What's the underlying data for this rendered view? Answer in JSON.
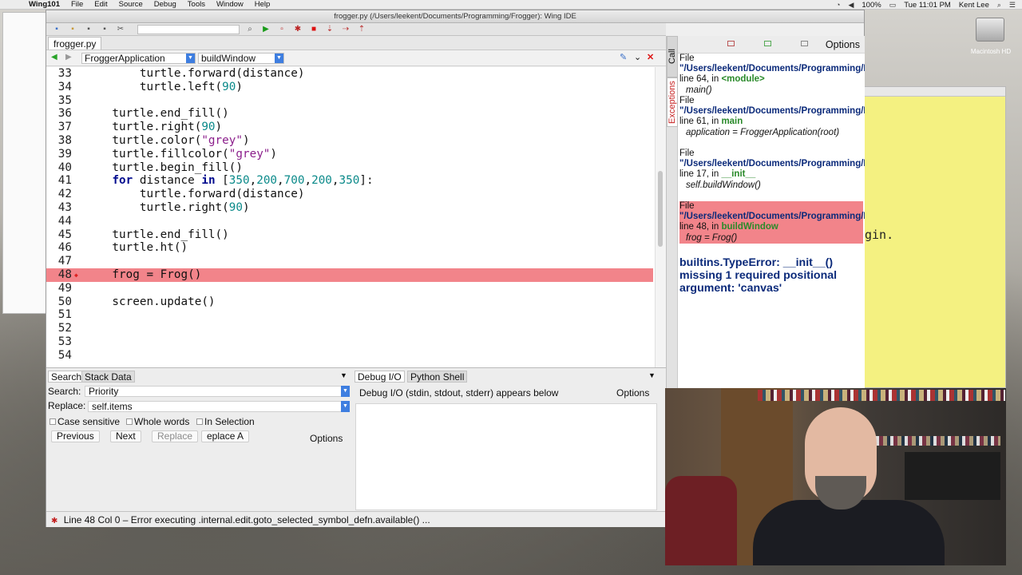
{
  "menubar": {
    "app": "Wing101",
    "items": [
      "File",
      "Edit",
      "Source",
      "Debug",
      "Tools",
      "Window",
      "Help"
    ],
    "battery": "100%",
    "clock": "Tue 11:01 PM",
    "user": "Kent Lee"
  },
  "desktop": {
    "hd_label": "Macintosh HD",
    "back_window_text": "gin."
  },
  "window": {
    "title": "frogger.py (/Users/leekent/Documents/Programming/Frogger): Wing IDE"
  },
  "editor": {
    "file_tab": "frogger.py",
    "class_combo": "FroggerApplication",
    "method_combo": "buildWindow",
    "lines": [
      {
        "n": "33",
        "html": "        turtle.forward(distance)"
      },
      {
        "n": "34",
        "html": "        turtle.left(90)"
      },
      {
        "n": "35",
        "html": ""
      },
      {
        "n": "36",
        "html": "    turtle.end_fill()"
      },
      {
        "n": "37",
        "html": "    turtle.right(90)"
      },
      {
        "n": "38",
        "html": "    turtle.color(\"grey\")"
      },
      {
        "n": "39",
        "html": "    turtle.fillcolor(\"grey\")"
      },
      {
        "n": "40",
        "html": "    turtle.begin_fill()"
      },
      {
        "n": "41",
        "html": "    for distance in [350,200,700,200,350]:"
      },
      {
        "n": "42",
        "html": "        turtle.forward(distance)"
      },
      {
        "n": "43",
        "html": "        turtle.right(90)"
      },
      {
        "n": "44",
        "html": ""
      },
      {
        "n": "45",
        "html": "    turtle.end_fill()"
      },
      {
        "n": "46",
        "html": "    turtle.ht()"
      },
      {
        "n": "47",
        "html": ""
      },
      {
        "n": "48",
        "html": "    frog = Frog()",
        "error": true
      },
      {
        "n": "49",
        "html": ""
      },
      {
        "n": "50",
        "html": "    screen.update()"
      },
      {
        "n": "51",
        "html": ""
      },
      {
        "n": "52",
        "html": ""
      },
      {
        "n": "53",
        "html": ""
      },
      {
        "n": "54",
        "html": ""
      }
    ]
  },
  "search_panel": {
    "tab_search": "Search",
    "tab_stack": "Stack Data",
    "search_label": "Search:",
    "search_value": "Priority",
    "replace_label": "Replace:",
    "replace_value": "self.items",
    "case_sensitive": "Case sensitive",
    "whole_words": "Whole words",
    "in_selection": "In Selection",
    "previous": "Previous",
    "next": "Next",
    "replace": "Replace",
    "replace_all": "eplace A",
    "options": "Options"
  },
  "debug_panel": {
    "tab_debug": "Debug I/O",
    "tab_shell": "Python Shell",
    "info": "Debug I/O (stdin, stdout, stderr) appears below",
    "options": "Options"
  },
  "status": {
    "text": "Line 48 Col 0 – Error executing .internal.edit.goto_selected_symbol_defn.available() ..."
  },
  "exceptions": {
    "vtab_call_stack": "Call Stack",
    "vtab_exceptions": "Exceptions",
    "options": "Options",
    "frames": [
      {
        "pre": "File ",
        "path": "\"/Users/leekent/Documents/Programming/Frogger/frogger.py\"",
        "mid": ", line 64, in ",
        "func": "<module>",
        "stmt": "main()"
      },
      {
        "pre": "File ",
        "path": "\"/Users/leekent/Documents/Programming/Frogger/frogger.py\"",
        "mid": ", line 61, in ",
        "func": "main",
        "stmt": "application = FroggerApplication(root)"
      },
      {
        "pre": "File ",
        "path": "\"/Users/leekent/Documents/Programming/Frogger/frogger.py\"",
        "mid": ", line 17, in ",
        "func": "__init__",
        "stmt": "self.buildWindow()"
      },
      {
        "pre": "File ",
        "path": "\"/Users/leekent/Documents/Programming/Frogger/frogger.py\"",
        "mid": ", line 48, in ",
        "func": "buildWindow",
        "stmt": "frog = Frog()",
        "error": true
      }
    ],
    "message": "builtins.TypeError: __init__() missing 1 required positional argument: 'canvas'"
  },
  "colors": {
    "error_highlight": "#f2848a",
    "keyword": "#000a8e",
    "number": "#0b8a8a",
    "string": "#8b1e8b",
    "path": "#0b2a7a",
    "func": "#2a8a2a"
  }
}
